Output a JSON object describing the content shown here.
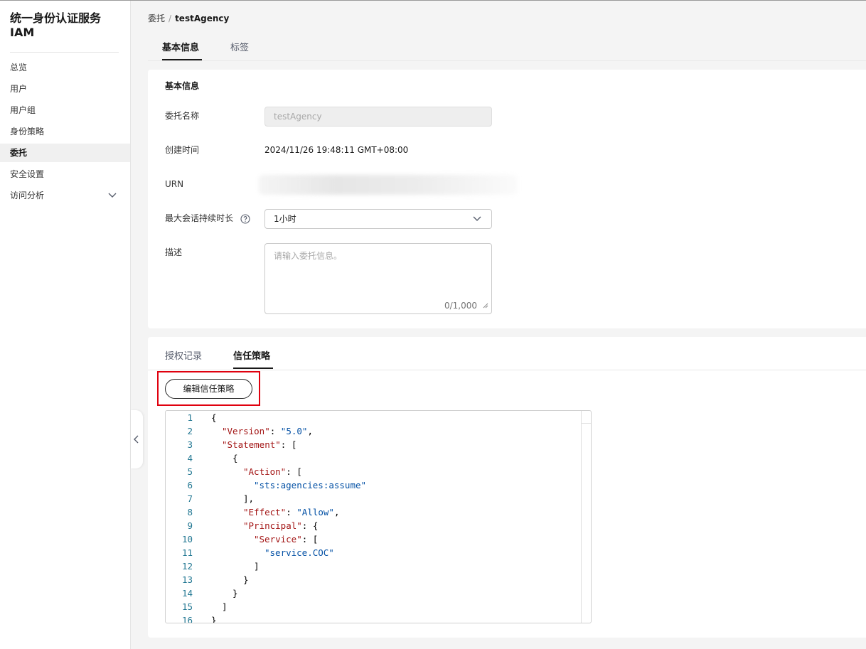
{
  "sidebar": {
    "title_line1": "统一身份认证服务",
    "title_line2": "IAM",
    "items": [
      {
        "label": "总览"
      },
      {
        "label": "用户"
      },
      {
        "label": "用户组"
      },
      {
        "label": "身份策略"
      },
      {
        "label": "委托",
        "active": true
      },
      {
        "label": "安全设置"
      },
      {
        "label": "访问分析",
        "expandable": true
      }
    ]
  },
  "breadcrumb": {
    "parent": "委托",
    "separator": "/",
    "current": "testAgency"
  },
  "top_tabs": [
    {
      "label": "基本信息",
      "active": true
    },
    {
      "label": "标签",
      "active": false
    }
  ],
  "basic_info": {
    "section_title": "基本信息",
    "name_label": "委托名称",
    "name_value": "testAgency",
    "created_label": "创建时间",
    "created_value": "2024/11/26 19:48:11 GMT+08:00",
    "urn_label": "URN",
    "session_label": "最大会话持续时长",
    "session_value": "1小时",
    "desc_label": "描述",
    "desc_placeholder": "请输入委托信息。",
    "desc_count": "0/1,000"
  },
  "policy_tabs": [
    {
      "label": "授权记录",
      "active": false
    },
    {
      "label": "信任策略",
      "active": true
    }
  ],
  "edit_button_label": "编辑信任策略",
  "code_lines": [
    {
      "n": "1",
      "indent": 0,
      "tokens": [
        [
          "p",
          "{"
        ]
      ]
    },
    {
      "n": "2",
      "indent": 1,
      "tokens": [
        [
          "k",
          "\"Version\""
        ],
        [
          "p",
          ": "
        ],
        [
          "s",
          "\"5.0\""
        ],
        [
          "p",
          ","
        ]
      ]
    },
    {
      "n": "3",
      "indent": 1,
      "tokens": [
        [
          "k",
          "\"Statement\""
        ],
        [
          "p",
          ": ["
        ]
      ]
    },
    {
      "n": "4",
      "indent": 2,
      "tokens": [
        [
          "p",
          "{"
        ]
      ]
    },
    {
      "n": "5",
      "indent": 3,
      "tokens": [
        [
          "k",
          "\"Action\""
        ],
        [
          "p",
          ": ["
        ]
      ]
    },
    {
      "n": "6",
      "indent": 4,
      "tokens": [
        [
          "s",
          "\"sts:agencies:assume\""
        ]
      ]
    },
    {
      "n": "7",
      "indent": 3,
      "tokens": [
        [
          "p",
          "],"
        ]
      ]
    },
    {
      "n": "8",
      "indent": 3,
      "tokens": [
        [
          "k",
          "\"Effect\""
        ],
        [
          "p",
          ": "
        ],
        [
          "s",
          "\"Allow\""
        ],
        [
          "p",
          ","
        ]
      ]
    },
    {
      "n": "9",
      "indent": 3,
      "tokens": [
        [
          "k",
          "\"Principal\""
        ],
        [
          "p",
          ": {"
        ]
      ]
    },
    {
      "n": "10",
      "indent": 4,
      "tokens": [
        [
          "k",
          "\"Service\""
        ],
        [
          "p",
          ": ["
        ]
      ]
    },
    {
      "n": "11",
      "indent": 5,
      "tokens": [
        [
          "s",
          "\"service.COC\""
        ]
      ]
    },
    {
      "n": "12",
      "indent": 4,
      "tokens": [
        [
          "p",
          "]"
        ]
      ]
    },
    {
      "n": "13",
      "indent": 3,
      "tokens": [
        [
          "p",
          "}"
        ]
      ]
    },
    {
      "n": "14",
      "indent": 2,
      "tokens": [
        [
          "p",
          "}"
        ]
      ]
    },
    {
      "n": "15",
      "indent": 1,
      "tokens": [
        [
          "p",
          "]"
        ]
      ]
    },
    {
      "n": "16",
      "indent": 0,
      "tokens": [
        [
          "p",
          "}"
        ]
      ]
    }
  ],
  "colors": {
    "accent": "#191919",
    "highlight": "#e0000e",
    "json_key": "#a31515",
    "json_string": "#0451a5",
    "line_number": "#237893"
  }
}
